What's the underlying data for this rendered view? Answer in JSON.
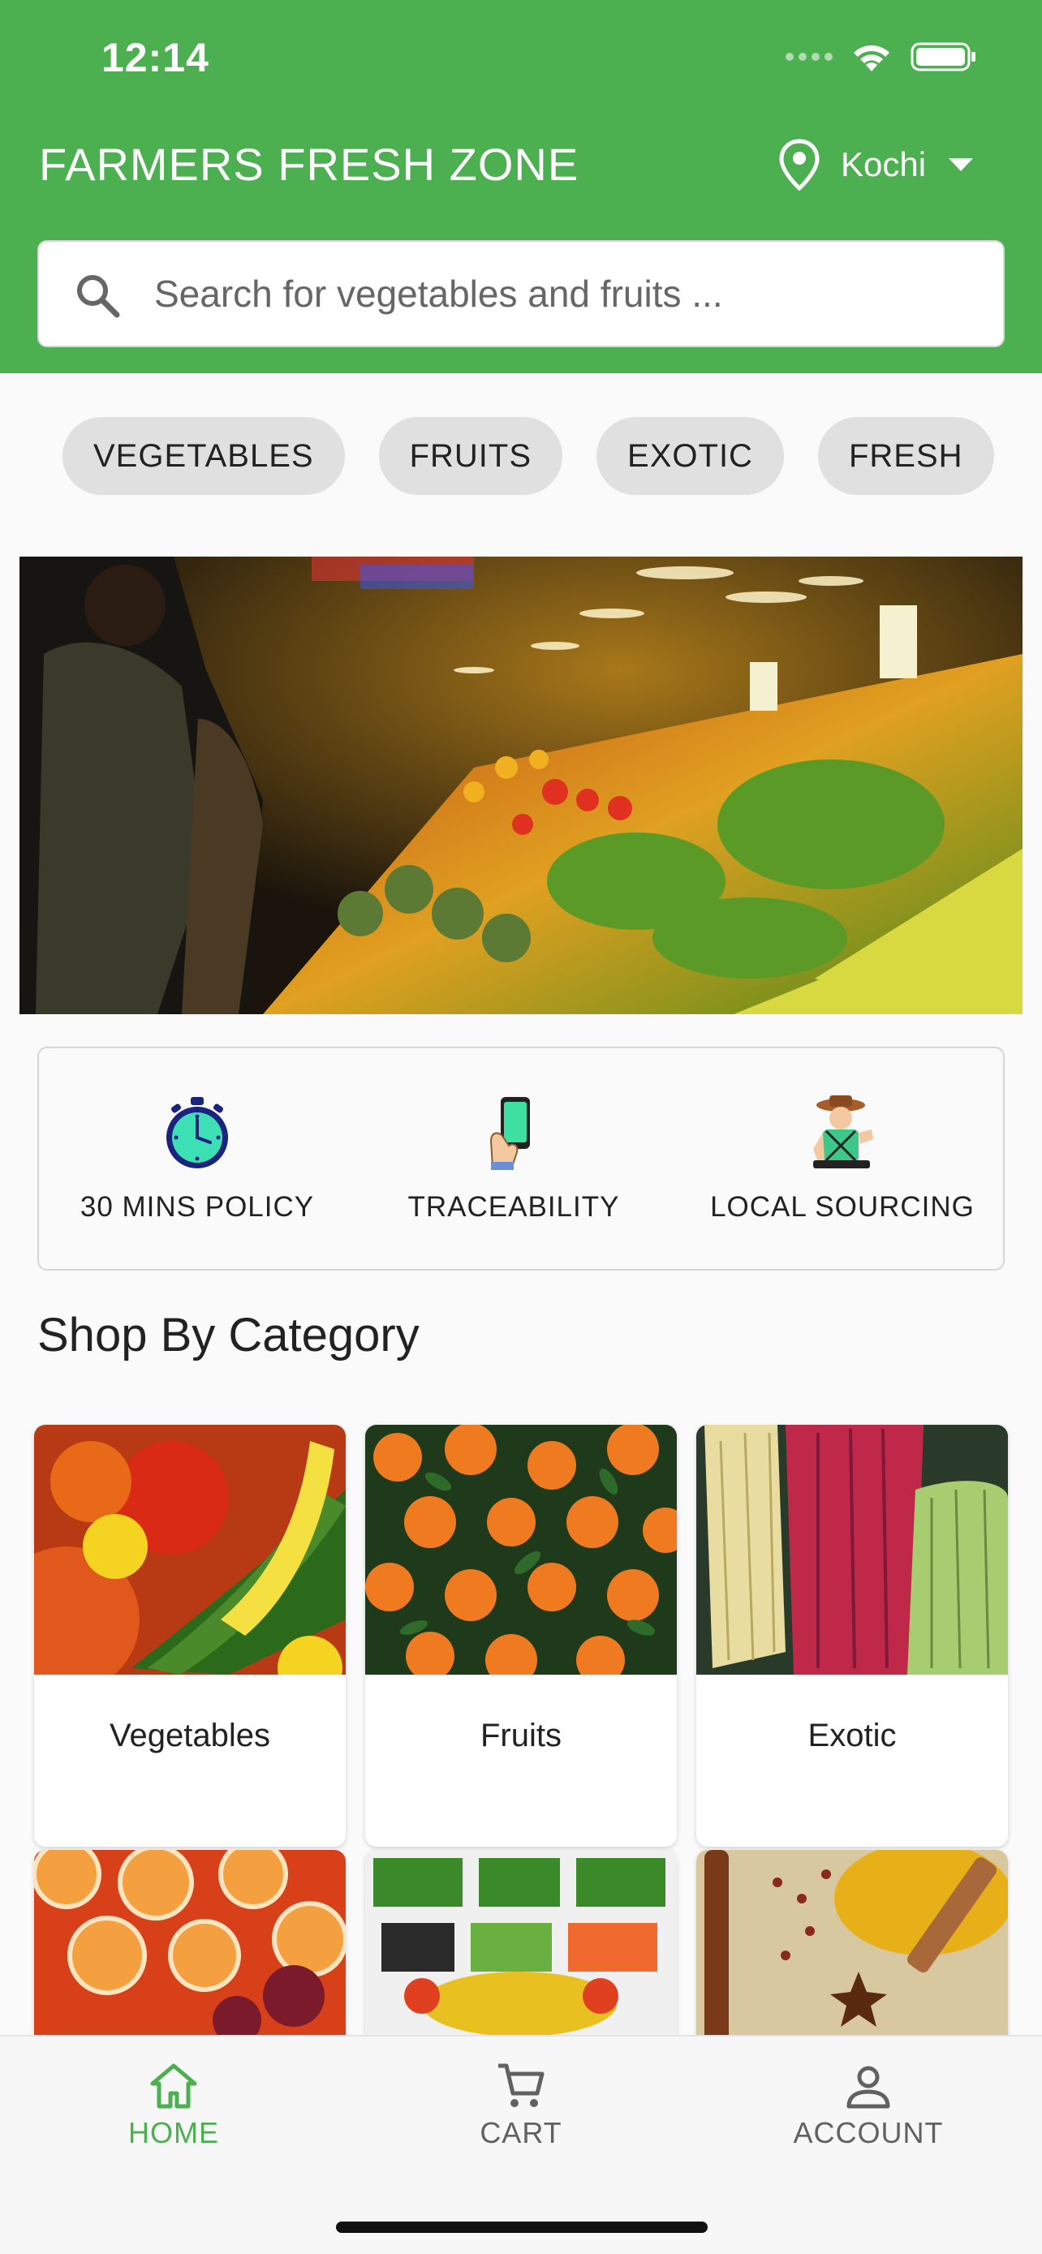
{
  "status_bar": {
    "time": "12:14"
  },
  "header": {
    "title": "FARMERS FRESH ZONE",
    "location": "Kochi",
    "search": {
      "placeholder": "Search for vegetables and fruits ..."
    }
  },
  "chips": [
    {
      "label": "VEGETABLES"
    },
    {
      "label": "FRUITS"
    },
    {
      "label": "EXOTIC"
    },
    {
      "label": "FRESH"
    }
  ],
  "features": [
    {
      "label": "30 MINS POLICY",
      "icon": "stopwatch-icon"
    },
    {
      "label": "TRACEABILITY",
      "icon": "phone-hand-icon"
    },
    {
      "label": "LOCAL SOURCING",
      "icon": "farmer-icon"
    }
  ],
  "section": {
    "title": "Shop By Category"
  },
  "categories": [
    {
      "label": "Vegetables"
    },
    {
      "label": "Fruits"
    },
    {
      "label": "Exotic"
    }
  ],
  "bottom_nav": [
    {
      "label": "HOME",
      "icon": "home-icon",
      "active": true
    },
    {
      "label": "CART",
      "icon": "cart-icon",
      "active": false
    },
    {
      "label": "ACCOUNT",
      "icon": "account-icon",
      "active": false
    }
  ],
  "colors": {
    "primary": "#4caf50",
    "chip_bg": "#e0e0e0",
    "nav_inactive": "#616161"
  }
}
